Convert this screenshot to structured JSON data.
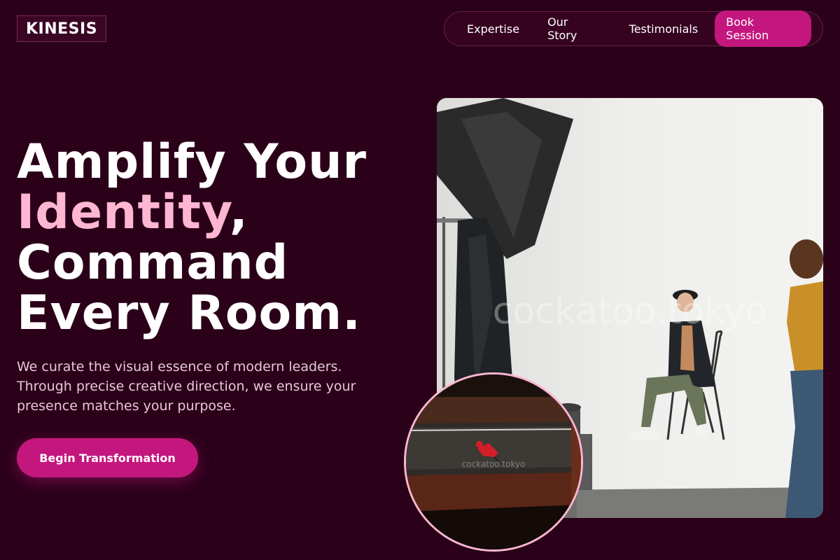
{
  "brand": {
    "logo": "KINESIS"
  },
  "nav": {
    "items": [
      "Expertise",
      "Our Story",
      "Testimonials"
    ],
    "cta": "Book Session"
  },
  "hero": {
    "line1": "Amplify Your",
    "accent": "Identity",
    "comma": ",",
    "line3": "Command",
    "line4": "Every Room.",
    "subtitle": "We curate the visual essence of modern leaders. Through precise creative direction, we ensure your presence matches your purpose.",
    "button": "Begin Transformation"
  },
  "media": {
    "main_watermark": "cockatoo.tokyo",
    "inset_watermark": "cockatoo.tokyo"
  },
  "colors": {
    "background": "#2a0119",
    "accent": "#c4177e",
    "highlight": "#ffb6d1"
  }
}
